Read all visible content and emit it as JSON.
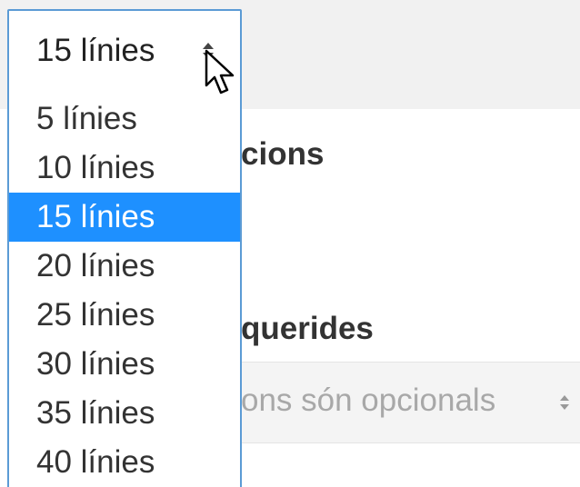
{
  "select": {
    "value": "15 línies",
    "options": [
      "5 línies",
      "10 línies",
      "15 línies",
      "20 línies",
      "25 línies",
      "30 línies",
      "35 línies",
      "40 línies"
    ],
    "selected_index": 2
  },
  "background": {
    "heading_opcions": "cions",
    "heading_requerides": "querides",
    "select_placeholder": "ons són opcionals"
  },
  "colors": {
    "highlight": "#1e90ff",
    "focus_border": "#5b9bd5"
  },
  "icons": {
    "select_arrows": "sort-arrows-icon",
    "cursor": "mouse-pointer-icon"
  }
}
